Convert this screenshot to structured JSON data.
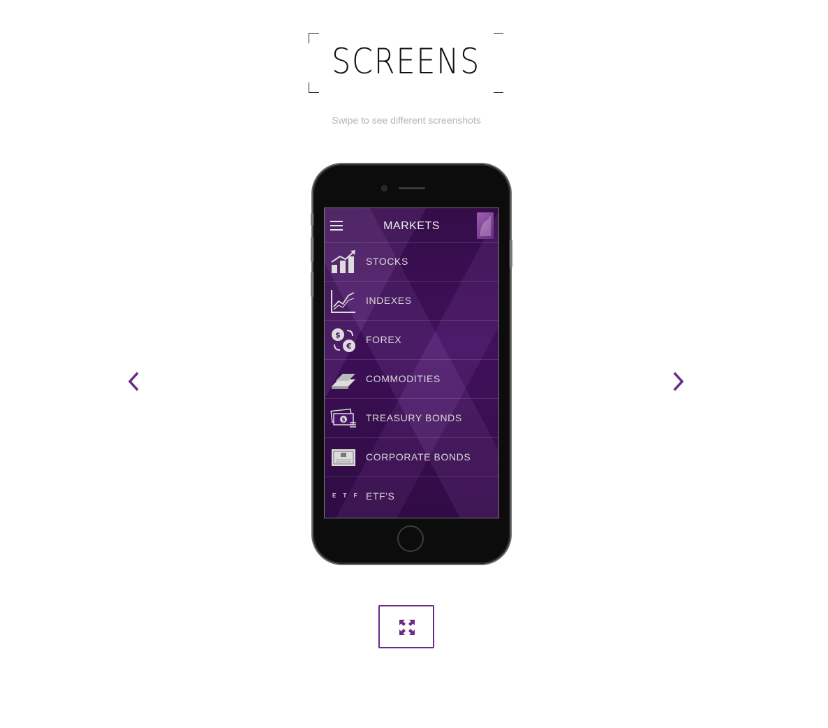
{
  "header": {
    "title": "SCREENS",
    "subtitle": "Swipe to see different screenshots"
  },
  "colors": {
    "accent": "#6b2a86",
    "screen_bg": "#4a136a",
    "subtitle_text": "#b4b4b4"
  },
  "icons": {
    "prev": "chevron-left-icon",
    "next": "chevron-right-icon",
    "fullscreen": "expand-icon",
    "menu": "hamburger-icon"
  },
  "phone_screen": {
    "title": "MARKETS",
    "items": [
      {
        "label": "STOCKS",
        "icon": "bar-chart-icon"
      },
      {
        "label": "INDEXES",
        "icon": "line-chart-icon"
      },
      {
        "label": "FOREX",
        "icon": "currency-exchange-icon"
      },
      {
        "label": "COMMODITIES",
        "icon": "gold-bars-icon"
      },
      {
        "label": "TREASURY BONDS",
        "icon": "cash-stack-icon"
      },
      {
        "label": "CORPORATE BONDS",
        "icon": "certificate-icon"
      },
      {
        "label": "ETF'S",
        "icon": "etf-icon",
        "icon_text": "E T F"
      }
    ]
  }
}
